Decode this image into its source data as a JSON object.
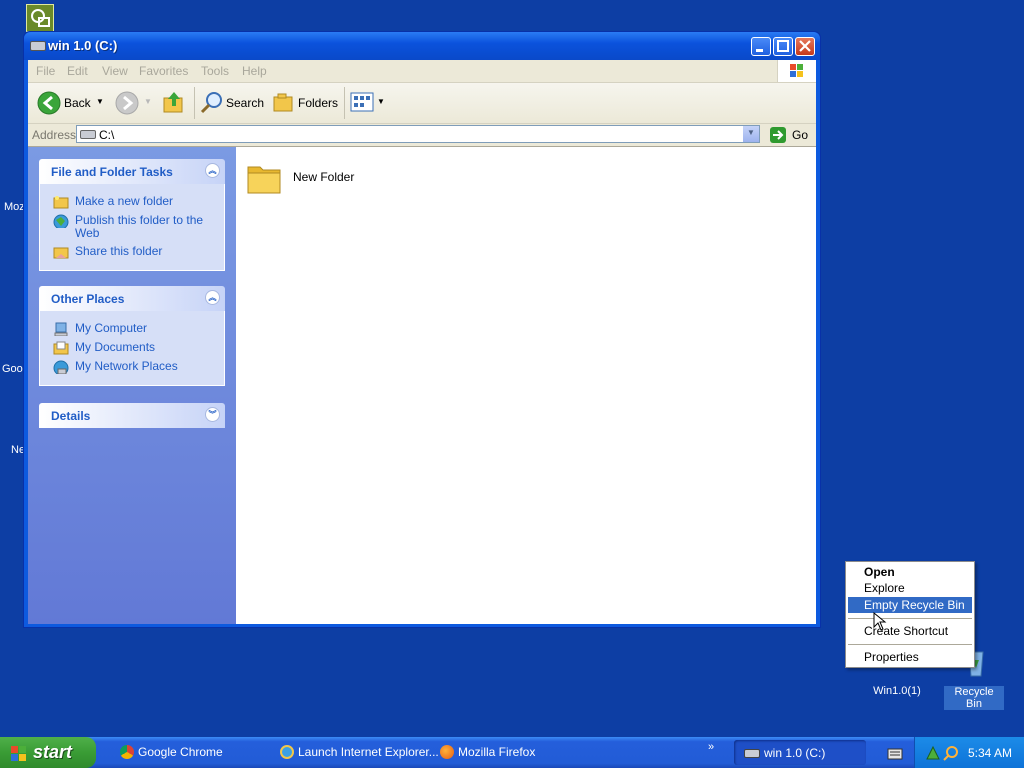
{
  "window": {
    "title": "win 1.0 (C:)",
    "menu": [
      "File",
      "Edit",
      "View",
      "Favorites",
      "Tools",
      "Help"
    ],
    "toolbar": {
      "back": "Back",
      "search": "Search",
      "folders": "Folders"
    },
    "address": {
      "label": "Address",
      "value": "C:\\",
      "go": "Go"
    },
    "tasks_panel": {
      "title": "File and Folder Tasks",
      "items": [
        "Make a new folder",
        "Publish this folder to the Web",
        "Share this folder"
      ]
    },
    "places_panel": {
      "title": "Other Places",
      "items": [
        "My Computer",
        "My Documents",
        "My Network Places"
      ]
    },
    "details_panel": {
      "title": "Details"
    },
    "content": {
      "folder_name": "New Folder"
    }
  },
  "desktop": {
    "fragments": [
      "Moz",
      "Goo",
      "Ne"
    ],
    "icons": {
      "win10": "Win1.0(1)",
      "recycle": "Recycle Bin"
    }
  },
  "context_menu": {
    "items": [
      "Open",
      "Explore",
      "Empty Recycle Bin",
      "Create Shortcut",
      "Properties"
    ]
  },
  "taskbar": {
    "start": "start",
    "quicklaunch": [
      "Google Chrome",
      "Launch Internet Explorer...",
      "Mozilla Firefox"
    ],
    "active_task": "win 1.0 (C:)",
    "clock": "5:34 AM"
  }
}
